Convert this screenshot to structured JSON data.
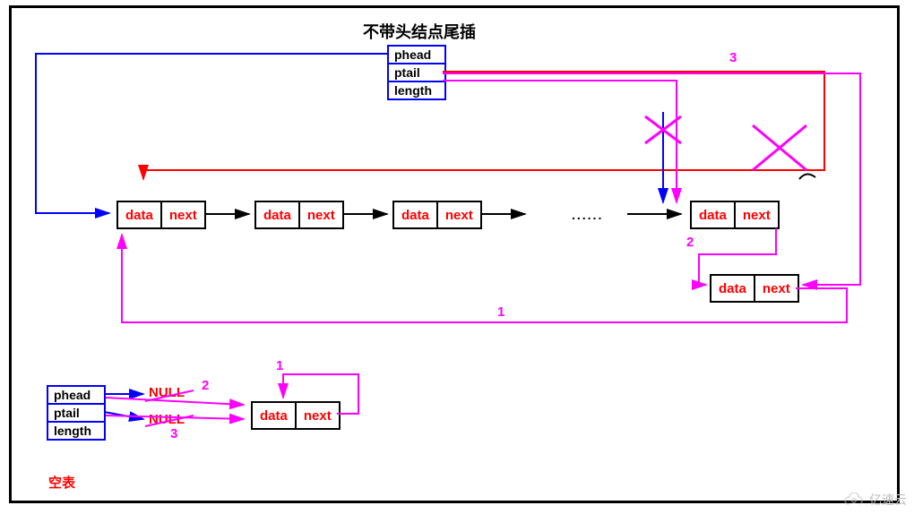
{
  "title": "不带头结点尾插",
  "struct_fields": {
    "f1": "phead",
    "f2": "ptail",
    "f3": "length"
  },
  "node_labels": {
    "data": "data",
    "next": "next"
  },
  "ellipsis": "......",
  "step_labels": {
    "s1": "1",
    "s2": "2",
    "s3": "3"
  },
  "bottom": {
    "null1": "NULL",
    "null2": "NULL",
    "s1": "1",
    "s2": "2",
    "s3": "3",
    "empty_label": "空表"
  },
  "watermark": "亿速云",
  "colors": {
    "blue": "#0000ff",
    "red": "#ff0000",
    "magenta": "#ff00ff",
    "black": "#000000"
  },
  "chart_data": {
    "type": "diagram",
    "subject": "Singly linked list tail-insert without header node",
    "list_struct": [
      "phead",
      "ptail",
      "length"
    ],
    "node_fields": [
      "data",
      "next"
    ],
    "main_sequence_nodes": 5,
    "pointers": [
      {
        "name": "phead",
        "points_to": "first node",
        "color": "blue"
      },
      {
        "name": "ptail",
        "points_to": "last node (before insert)",
        "color": "red",
        "updated_to": "new node",
        "updated_color": "magenta"
      }
    ],
    "tail_insert_steps": [
      {
        "step": 1,
        "desc": "new_node->next = NULL (loop back shown)",
        "color": "magenta"
      },
      {
        "step": 2,
        "desc": "ptail->next = new_node",
        "color": "magenta"
      },
      {
        "step": 3,
        "desc": "ptail = new_node",
        "color": "magenta"
      }
    ],
    "empty_list_case": {
      "label": "空表",
      "initial": {
        "phead": "NULL",
        "ptail": "NULL"
      },
      "steps": [
        {
          "step": 1,
          "desc": "new_node->next = NULL"
        },
        {
          "step": 2,
          "desc": "phead = new_node"
        },
        {
          "step": 3,
          "desc": "ptail = new_node"
        }
      ]
    }
  }
}
